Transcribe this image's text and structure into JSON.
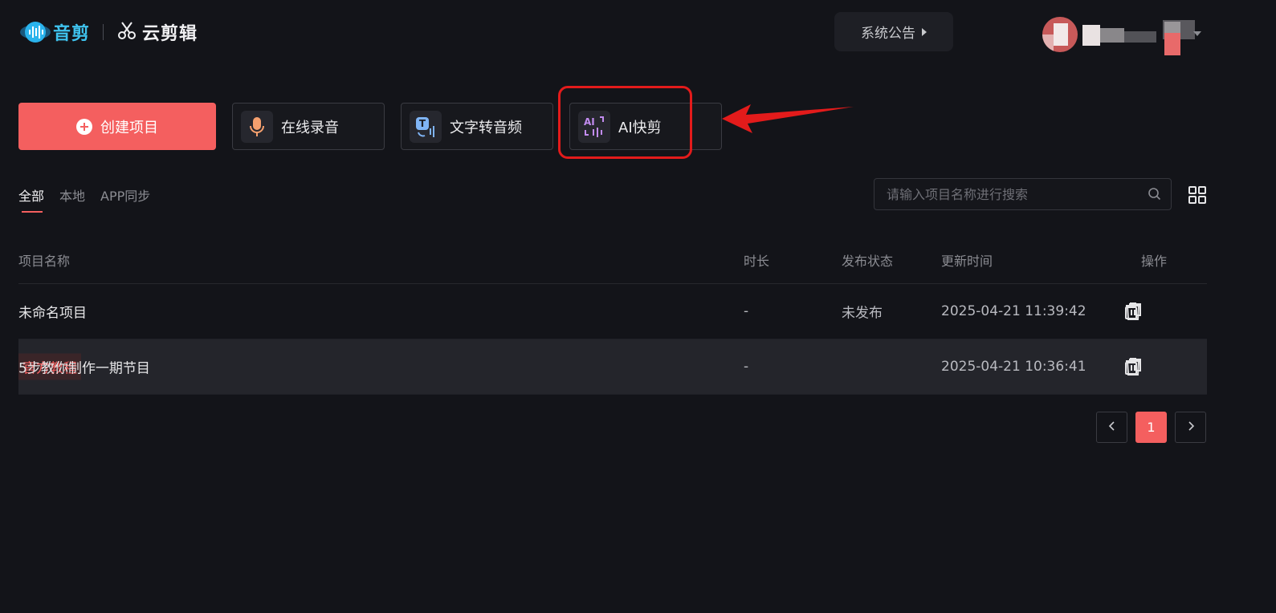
{
  "header": {
    "logo_text": "音剪",
    "cloud_editor_text": "云剪辑",
    "notice_label": "系统公告"
  },
  "actions": {
    "create_project": "创建项目",
    "online_record": "在线录音",
    "text_to_audio": "文字转音频",
    "ai_quick_cut": "AI快剪"
  },
  "tabs": [
    {
      "label": "全部",
      "active": true
    },
    {
      "label": "本地",
      "active": false
    },
    {
      "label": "APP同步",
      "active": false
    }
  ],
  "search": {
    "placeholder": "请输入项目名称进行搜索"
  },
  "table": {
    "headers": {
      "name": "项目名称",
      "duration": "时长",
      "status": "发布状态",
      "updated": "更新时间",
      "actions": "操作"
    },
    "rows": [
      {
        "tag": "",
        "name": "未命名项目",
        "duration": "-",
        "status": "未发布",
        "updated": "2025-04-21 11:39:42"
      },
      {
        "tag": "官方教程",
        "name": "5步教你制作一期节目",
        "duration": "-",
        "status": "",
        "updated": "2025-04-21 10:36:41"
      }
    ]
  },
  "pagination": {
    "current": "1",
    "prev_icon": "chevron-left-icon",
    "next_icon": "chevron-right-icon"
  },
  "colors": {
    "accent": "#f45f5f",
    "brand_blue": "#3fc3ee",
    "annotation_red": "#e31b1b",
    "background": "#131419"
  }
}
